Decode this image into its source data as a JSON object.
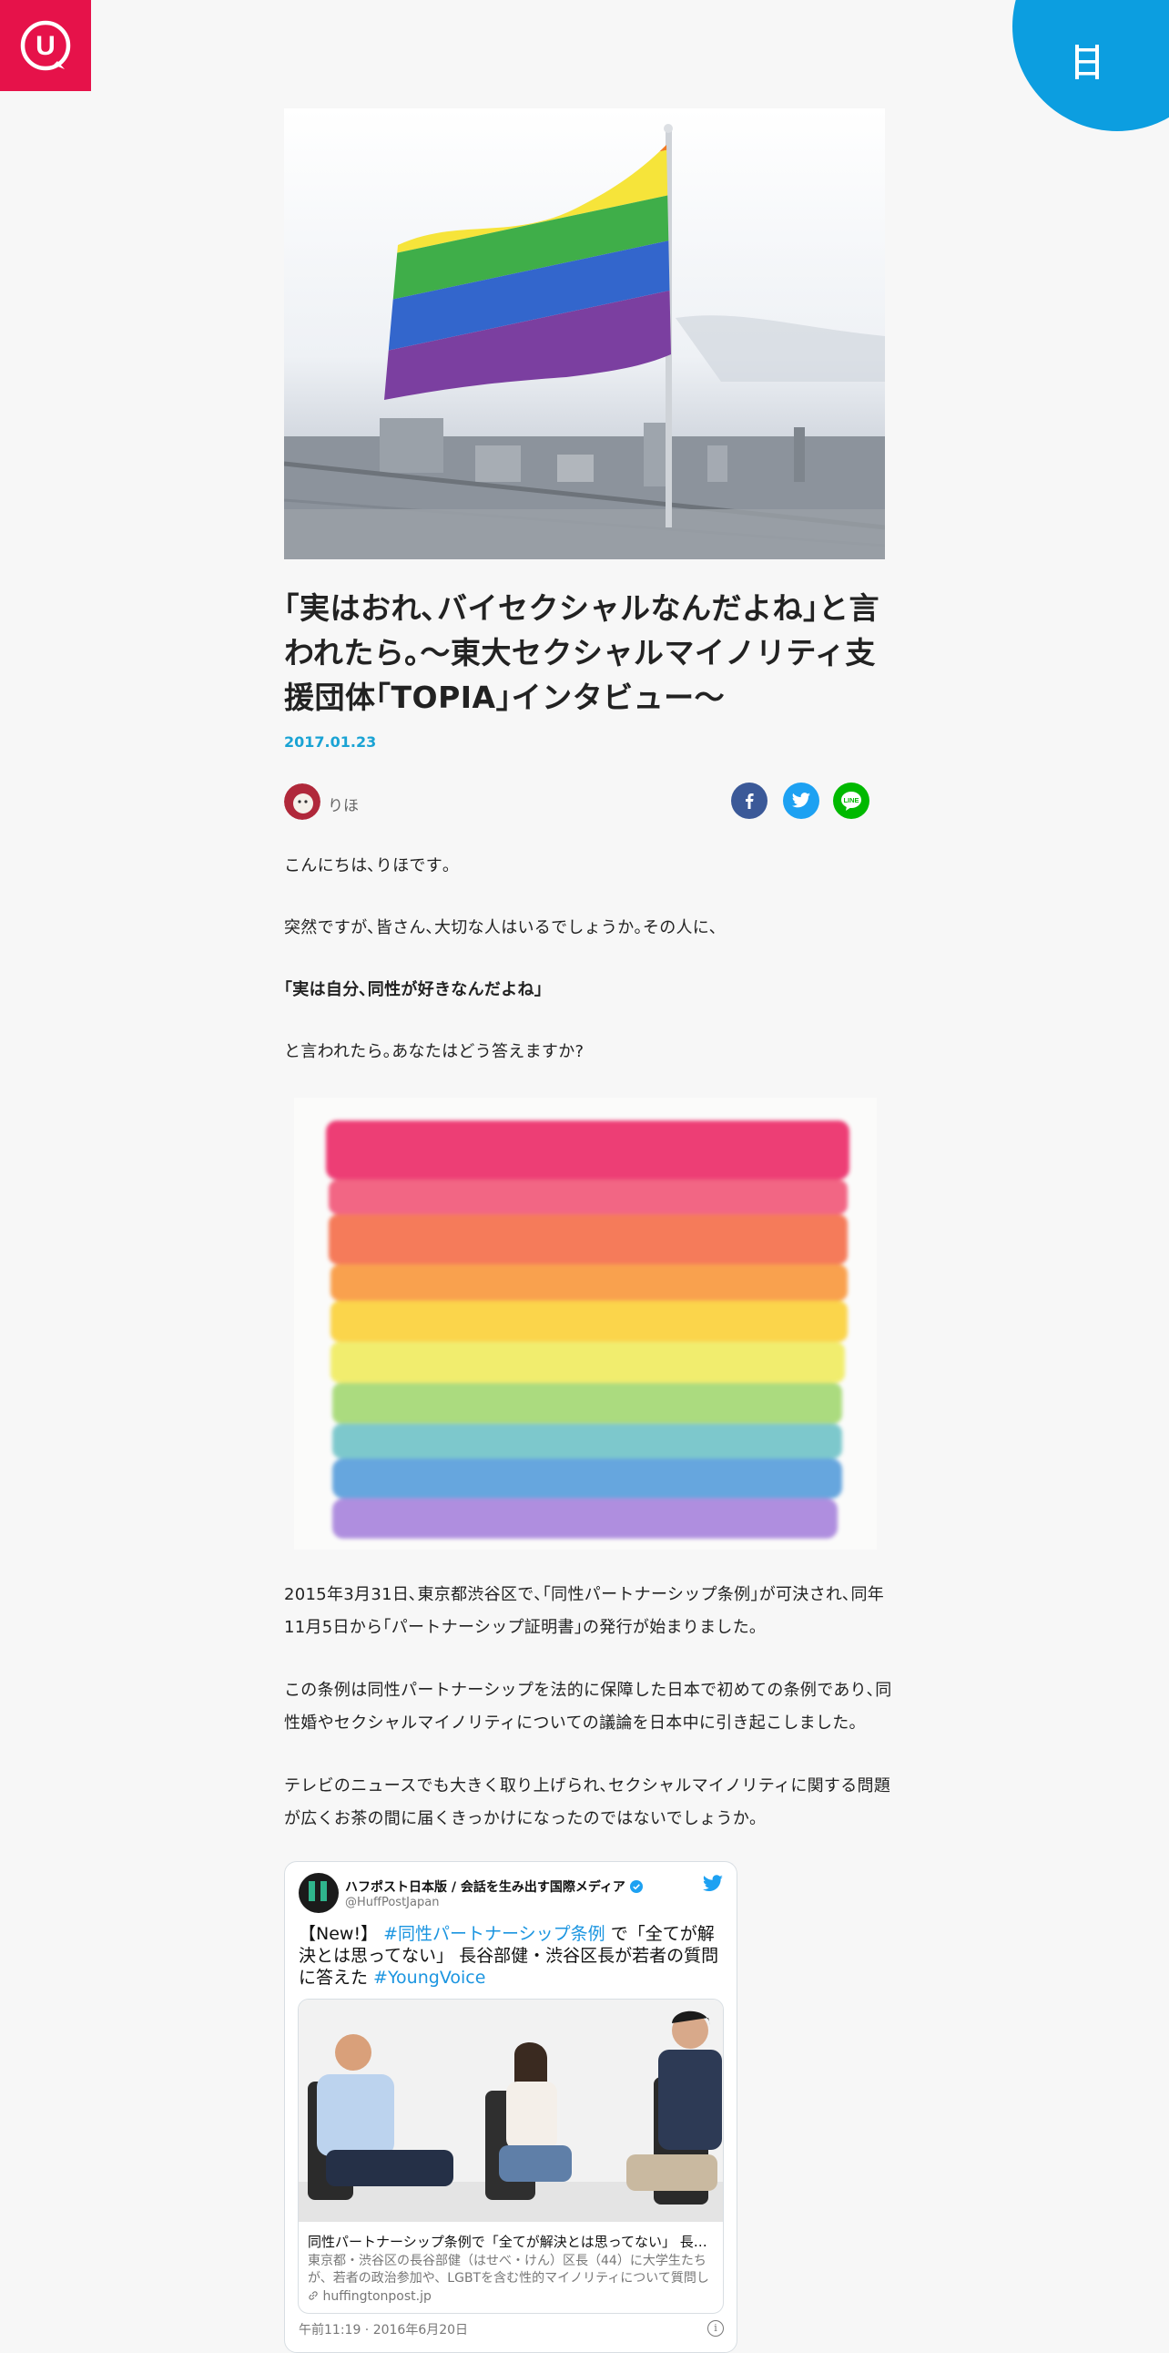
{
  "header": {
    "logo_letter": "U",
    "menu_icon": "ladder-menu-icon"
  },
  "article": {
    "title": "｢実はおれ､バイセクシャルなんだよね｣と言われたら｡〜東大セクシャルマイノリティ支援団体｢TOPIA｣インタビュー〜",
    "date": "2017.01.23",
    "author": "りほ",
    "paragraphs": {
      "p1": "こんにちは､りほです｡",
      "p2": "突然ですが､皆さん､大切な人はいるでしょうか｡その人に､",
      "p3": "｢実は自分､同性が好きなんだよね｣",
      "p4": "と言われたら｡あなたはどう答えますか?",
      "p5": "2015年3月31日､東京都渋谷区で､｢同性パートナーシップ条例｣が可決され､同年11月5日から｢パートナーシップ証明書｣の発行が始まりました｡",
      "p6": "この条例は同性パートナーシップを法的に保障した日本で初めての条例であり､同性婚やセクシャルマイノリティについての議論を日本中に引き起こしました｡",
      "p7": "テレビのニュースでも大きく取り上げられ､セクシャルマイノリティに関する問題が広くお茶の間に届くきっかけになったのではないでしょうか｡"
    }
  },
  "share": {
    "facebook": "facebook-icon",
    "twitter": "twitter-icon",
    "line_label": "LINE"
  },
  "tweet": {
    "name": "ハフポスト日本版 / 会話を生み出す国際メディア",
    "handle": "@HuffPostJapan",
    "text_prefix": "【New!】 ",
    "hashtag1": "#同性パートナーシップ条例",
    "text_middle": " で「全てが解決とは思ってない」 長谷部健・渋谷区長が若者の質問に答えた ",
    "hashtag2": "#YoungVoice",
    "card_title": "同性パートナーシップ条例で「全てが解決とは思ってない」 長谷部健・渋谷区長が若者の質問に答えた",
    "card_desc": "東京都・渋谷区の長谷部健（はせべ・けん）区長（44）に大学生たちが、若者の政治参加や、LGBTを含む性的マイノリティについて質問した",
    "card_domain": "huffingtonpost.jp",
    "timestamp": "午前11:19 · 2016年6月20日",
    "info_glyph": "i"
  },
  "colors": {
    "brand": "#e6124a",
    "menu": "#0c9ee0",
    "date": "#1aa3d4",
    "link": "#1b95e0"
  }
}
